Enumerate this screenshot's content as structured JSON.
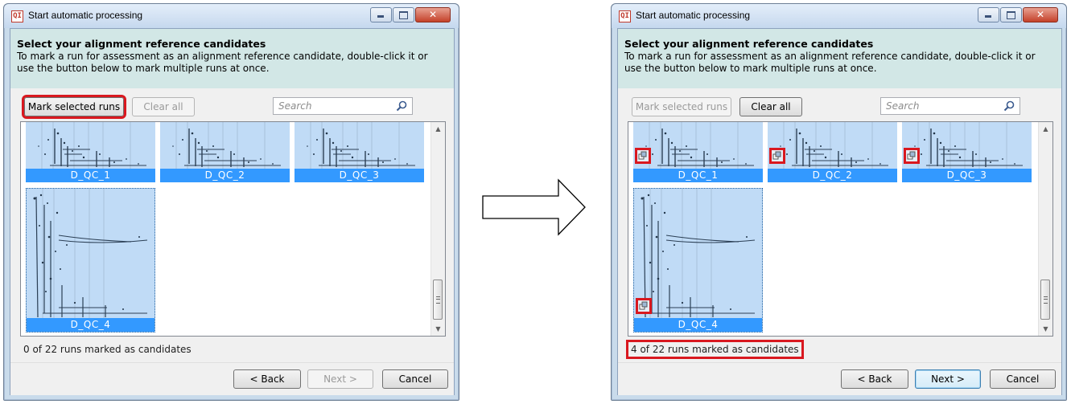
{
  "colors": {
    "highlight": "#d9181f",
    "tile_label_bg": "#3399ff",
    "tile_bg": "#c0dbf6",
    "header_band": "#d2e7e6"
  },
  "dialogs": [
    {
      "title": "Start automatic processing",
      "app_icon_text": "QI",
      "header_title": "Select your alignment reference candidates",
      "header_description": "To mark a run for assessment as an alignment reference candidate, double-click it or use the button below to mark multiple runs at once.",
      "mark_button": "Mark selected runs",
      "clear_button": "Clear all",
      "search_placeholder": "Search",
      "runs": [
        {
          "name": "D_QC_1",
          "marked": false
        },
        {
          "name": "D_QC_2",
          "marked": false
        },
        {
          "name": "D_QC_3",
          "marked": false
        },
        {
          "name": "D_QC_4",
          "marked": false
        }
      ],
      "status": "0 of 22 runs marked as candidates",
      "back_button": "< Back",
      "next_button": "Next >",
      "cancel_button": "Cancel"
    },
    {
      "title": "Start automatic processing",
      "app_icon_text": "QI",
      "header_title": "Select your alignment reference candidates",
      "header_description": "To mark a run for assessment as an alignment reference candidate, double-click it or use the button below to mark multiple runs at once.",
      "mark_button": "Mark selected runs",
      "clear_button": "Clear all",
      "search_placeholder": "Search",
      "runs": [
        {
          "name": "D_QC_1",
          "marked": true
        },
        {
          "name": "D_QC_2",
          "marked": true
        },
        {
          "name": "D_QC_3",
          "marked": true
        },
        {
          "name": "D_QC_4",
          "marked": true
        }
      ],
      "status": "4 of 22 runs marked as candidates",
      "back_button": "< Back",
      "next_button": "Next >",
      "cancel_button": "Cancel"
    }
  ]
}
